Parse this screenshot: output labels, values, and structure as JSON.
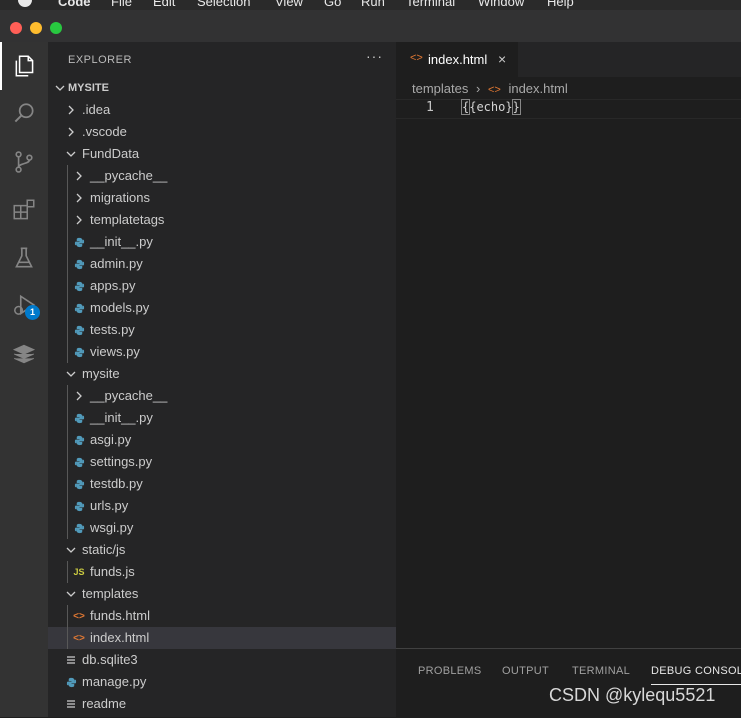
{
  "menubar": [
    "Code",
    "File",
    "Edit",
    "Selection",
    "View",
    "Go",
    "Run",
    "Terminal",
    "Window",
    "Help"
  ],
  "explorer": {
    "title": "EXPLORER",
    "more": "···",
    "root": "MYSITE",
    "tree": [
      {
        "label": ".idea",
        "type": "folder",
        "open": false,
        "depth": 1
      },
      {
        "label": ".vscode",
        "type": "folder",
        "open": false,
        "depth": 1
      },
      {
        "label": "FundData",
        "type": "folder",
        "open": true,
        "depth": 1
      },
      {
        "label": "__pycache__",
        "type": "folder",
        "open": false,
        "depth": 2
      },
      {
        "label": "migrations",
        "type": "folder",
        "open": false,
        "depth": 2
      },
      {
        "label": "templatetags",
        "type": "folder",
        "open": false,
        "depth": 2
      },
      {
        "label": "__init__.py",
        "type": "py",
        "depth": 2
      },
      {
        "label": "admin.py",
        "type": "py",
        "depth": 2
      },
      {
        "label": "apps.py",
        "type": "py",
        "depth": 2
      },
      {
        "label": "models.py",
        "type": "py",
        "depth": 2
      },
      {
        "label": "tests.py",
        "type": "py",
        "depth": 2
      },
      {
        "label": "views.py",
        "type": "py",
        "depth": 2
      },
      {
        "label": "mysite",
        "type": "folder",
        "open": true,
        "depth": 1
      },
      {
        "label": "__pycache__",
        "type": "folder",
        "open": false,
        "depth": 2
      },
      {
        "label": "__init__.py",
        "type": "py",
        "depth": 2
      },
      {
        "label": "asgi.py",
        "type": "py",
        "depth": 2
      },
      {
        "label": "settings.py",
        "type": "py",
        "depth": 2
      },
      {
        "label": "testdb.py",
        "type": "py",
        "depth": 2
      },
      {
        "label": "urls.py",
        "type": "py",
        "depth": 2
      },
      {
        "label": "wsgi.py",
        "type": "py",
        "depth": 2
      },
      {
        "label": "static/js",
        "type": "folder",
        "open": true,
        "depth": 1
      },
      {
        "label": "funds.js",
        "type": "js",
        "depth": 2
      },
      {
        "label": "templates",
        "type": "folder",
        "open": true,
        "depth": 1
      },
      {
        "label": "funds.html",
        "type": "html",
        "depth": 2
      },
      {
        "label": "index.html",
        "type": "html",
        "depth": 2,
        "selected": true
      },
      {
        "label": "db.sqlite3",
        "type": "txt",
        "depth": 1
      },
      {
        "label": "manage.py",
        "type": "py",
        "depth": 1
      },
      {
        "label": "readme",
        "type": "txt",
        "depth": 1
      }
    ]
  },
  "editor": {
    "tab": {
      "icon": "<>",
      "label": "index.html",
      "close": "×"
    },
    "breadcrumb": {
      "folder": "templates",
      "icon": "<>",
      "file": "index.html"
    },
    "line_number": "1",
    "code": {
      "open": "{",
      "inner": "{echo}",
      "close": "}"
    }
  },
  "panel": {
    "tabs": [
      "PROBLEMS",
      "OUTPUT",
      "TERMINAL",
      "DEBUG CONSOLE"
    ],
    "active": "DEBUG CONSOLE"
  },
  "activity": {
    "debug_badge": "1"
  },
  "watermark": "CSDN @kylequ5521",
  "colors": {
    "accent": "#007acc",
    "html_icon": "#e37933",
    "py_icon": "#519aba",
    "js_icon": "#cbcb41"
  }
}
